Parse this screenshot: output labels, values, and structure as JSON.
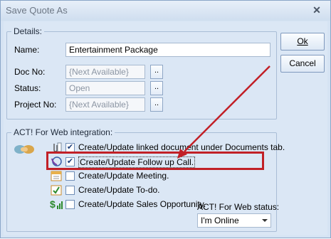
{
  "window": {
    "title": "Save Quote As",
    "close_glyph": "✕"
  },
  "details": {
    "group_label": "Details:",
    "name_label": "Name:",
    "name_value": "Entertainment Package",
    "docno_label": "Doc No:",
    "docno_value": "{Next Available}",
    "status_label": "Status:",
    "status_value": "Open",
    "projectno_label": "Project No:",
    "projectno_value": "{Next Available}",
    "browse_label": ".."
  },
  "buttons": {
    "ok_label": "Ok",
    "cancel_label": "Cancel"
  },
  "integration": {
    "group_label": "ACT! For Web integration:",
    "options": [
      {
        "label": "Create/Update linked document under Documents tab.",
        "checked": true,
        "icon": "paperclip-icon"
      },
      {
        "label": "Create/Update Follow up Call.",
        "checked": true,
        "icon": "phone-icon"
      },
      {
        "label": "Create/Update Meeting.",
        "checked": false,
        "icon": "calendar-icon"
      },
      {
        "label": "Create/Update To-do.",
        "checked": false,
        "icon": "todo-icon"
      },
      {
        "label": "Create/Update Sales Opportunity.",
        "checked": false,
        "icon": "dollar-icon"
      }
    ],
    "status_label": "ACT! For Web status:",
    "status_value": "I'm Online",
    "check_glyph": "✔"
  },
  "colors": {
    "highlight": "#c12027",
    "arrow": "#c12027"
  }
}
